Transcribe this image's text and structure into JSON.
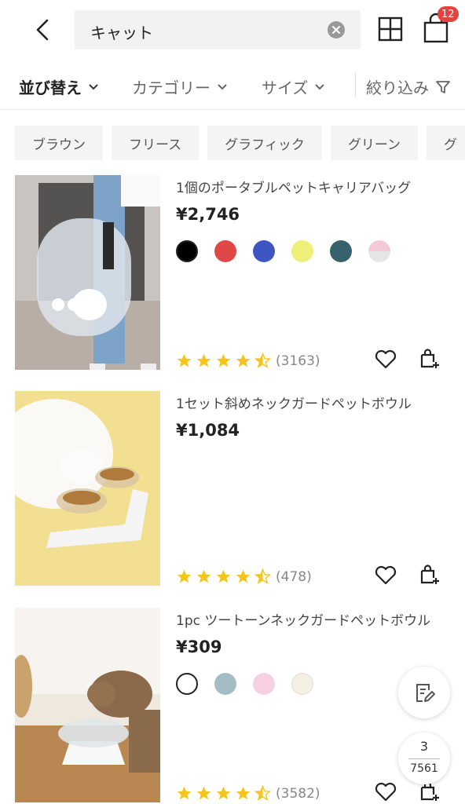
{
  "header": {
    "search_query": "キャット",
    "bag_badge": "12"
  },
  "filter_bar": {
    "sort_label": "並び替え",
    "category_label": "カテゴリー",
    "size_label": "サイズ",
    "filter_label": "絞り込み"
  },
  "chips": [
    "ブラウン",
    "フリース",
    "グラフィック",
    "グリーン",
    "グ"
  ],
  "products": [
    {
      "title": "1個のポータブルペットキャリアバッグ",
      "price": "¥2,746",
      "reviews": "(3163)",
      "rating": 4.5,
      "swatches": [
        "#000000",
        "#e04848",
        "#3f56c2",
        "#eef07a",
        "#35626c",
        "#f4c9d6"
      ]
    },
    {
      "title": "1セット斜めネックガードペットボウル",
      "price": "¥1,084",
      "reviews": "(478)",
      "rating": 4.5,
      "swatches": []
    },
    {
      "title": "1pc ツートーンネックガードペットボウル",
      "price": "¥309",
      "reviews": "(3582)",
      "rating": 4.5,
      "swatches": [
        "#ffffff",
        "#a4bdc4",
        "#f6cfe0",
        "#f3efe2"
      ]
    }
  ],
  "pager": {
    "current": "3",
    "total": "7561"
  },
  "colors": {
    "star": "#f5c51b",
    "badge": "#e64340"
  }
}
